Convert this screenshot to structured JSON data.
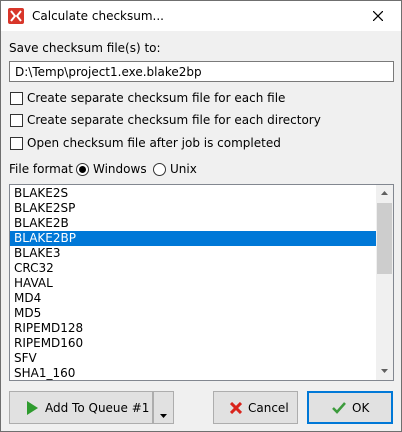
{
  "window": {
    "title": "Calculate checksum..."
  },
  "save_label": "Save checksum file(s) to:",
  "path_value": "D:\\Temp\\project1.exe.blake2bp",
  "options": {
    "separate_per_file": "Create separate checksum file for each file",
    "separate_per_dir": "Create separate checksum file for each directory",
    "open_after_job": "Open checksum file after job is completed"
  },
  "file_format": {
    "label": "File format",
    "windows": "Windows",
    "unix": "Unix",
    "selected": "Windows"
  },
  "algorithms": [
    "BLAKE2S",
    "BLAKE2SP",
    "BLAKE2B",
    "BLAKE2BP",
    "BLAKE3",
    "CRC32",
    "HAVAL",
    "MD4",
    "MD5",
    "RIPEMD128",
    "RIPEMD160",
    "SFV",
    "SHA1_160"
  ],
  "selected_algorithm": "BLAKE2BP",
  "buttons": {
    "add_to_queue": "Add To Queue #1",
    "cancel": "Cancel",
    "ok": "OK"
  },
  "colors": {
    "selection": "#0078d7",
    "play_icon": "#2e9b2e",
    "cancel_icon": "#d9241c",
    "ok_icon": "#3c9b3c"
  }
}
